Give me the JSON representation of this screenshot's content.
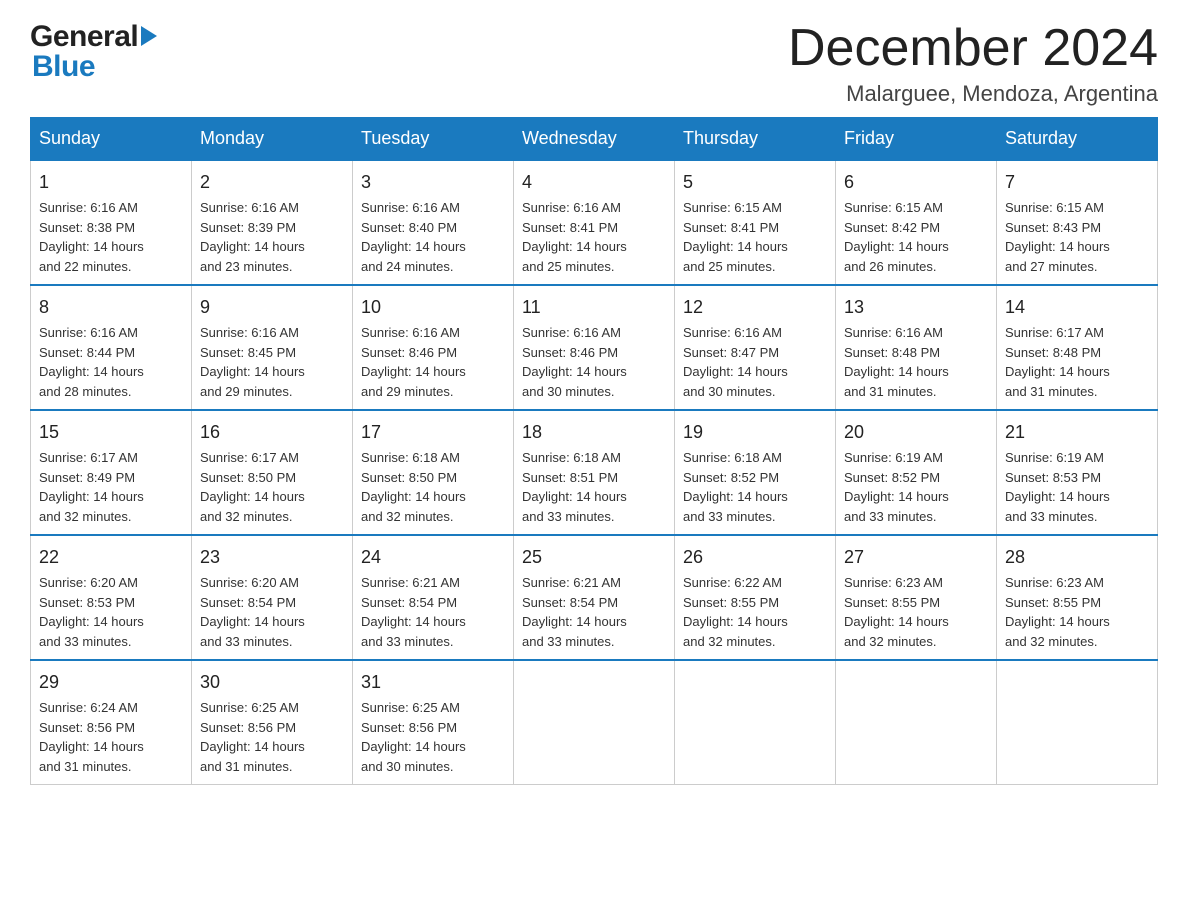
{
  "header": {
    "month_year": "December 2024",
    "location": "Malarguee, Mendoza, Argentina",
    "logo_general": "General",
    "logo_blue": "Blue"
  },
  "days_of_week": [
    "Sunday",
    "Monday",
    "Tuesday",
    "Wednesday",
    "Thursday",
    "Friday",
    "Saturday"
  ],
  "weeks": [
    [
      {
        "day": "1",
        "sunrise": "6:16 AM",
        "sunset": "8:38 PM",
        "daylight": "14 hours and 22 minutes."
      },
      {
        "day": "2",
        "sunrise": "6:16 AM",
        "sunset": "8:39 PM",
        "daylight": "14 hours and 23 minutes."
      },
      {
        "day": "3",
        "sunrise": "6:16 AM",
        "sunset": "8:40 PM",
        "daylight": "14 hours and 24 minutes."
      },
      {
        "day": "4",
        "sunrise": "6:16 AM",
        "sunset": "8:41 PM",
        "daylight": "14 hours and 25 minutes."
      },
      {
        "day": "5",
        "sunrise": "6:15 AM",
        "sunset": "8:41 PM",
        "daylight": "14 hours and 25 minutes."
      },
      {
        "day": "6",
        "sunrise": "6:15 AM",
        "sunset": "8:42 PM",
        "daylight": "14 hours and 26 minutes."
      },
      {
        "day": "7",
        "sunrise": "6:15 AM",
        "sunset": "8:43 PM",
        "daylight": "14 hours and 27 minutes."
      }
    ],
    [
      {
        "day": "8",
        "sunrise": "6:16 AM",
        "sunset": "8:44 PM",
        "daylight": "14 hours and 28 minutes."
      },
      {
        "day": "9",
        "sunrise": "6:16 AM",
        "sunset": "8:45 PM",
        "daylight": "14 hours and 29 minutes."
      },
      {
        "day": "10",
        "sunrise": "6:16 AM",
        "sunset": "8:46 PM",
        "daylight": "14 hours and 29 minutes."
      },
      {
        "day": "11",
        "sunrise": "6:16 AM",
        "sunset": "8:46 PM",
        "daylight": "14 hours and 30 minutes."
      },
      {
        "day": "12",
        "sunrise": "6:16 AM",
        "sunset": "8:47 PM",
        "daylight": "14 hours and 30 minutes."
      },
      {
        "day": "13",
        "sunrise": "6:16 AM",
        "sunset": "8:48 PM",
        "daylight": "14 hours and 31 minutes."
      },
      {
        "day": "14",
        "sunrise": "6:17 AM",
        "sunset": "8:48 PM",
        "daylight": "14 hours and 31 minutes."
      }
    ],
    [
      {
        "day": "15",
        "sunrise": "6:17 AM",
        "sunset": "8:49 PM",
        "daylight": "14 hours and 32 minutes."
      },
      {
        "day": "16",
        "sunrise": "6:17 AM",
        "sunset": "8:50 PM",
        "daylight": "14 hours and 32 minutes."
      },
      {
        "day": "17",
        "sunrise": "6:18 AM",
        "sunset": "8:50 PM",
        "daylight": "14 hours and 32 minutes."
      },
      {
        "day": "18",
        "sunrise": "6:18 AM",
        "sunset": "8:51 PM",
        "daylight": "14 hours and 33 minutes."
      },
      {
        "day": "19",
        "sunrise": "6:18 AM",
        "sunset": "8:52 PM",
        "daylight": "14 hours and 33 minutes."
      },
      {
        "day": "20",
        "sunrise": "6:19 AM",
        "sunset": "8:52 PM",
        "daylight": "14 hours and 33 minutes."
      },
      {
        "day": "21",
        "sunrise": "6:19 AM",
        "sunset": "8:53 PM",
        "daylight": "14 hours and 33 minutes."
      }
    ],
    [
      {
        "day": "22",
        "sunrise": "6:20 AM",
        "sunset": "8:53 PM",
        "daylight": "14 hours and 33 minutes."
      },
      {
        "day": "23",
        "sunrise": "6:20 AM",
        "sunset": "8:54 PM",
        "daylight": "14 hours and 33 minutes."
      },
      {
        "day": "24",
        "sunrise": "6:21 AM",
        "sunset": "8:54 PM",
        "daylight": "14 hours and 33 minutes."
      },
      {
        "day": "25",
        "sunrise": "6:21 AM",
        "sunset": "8:54 PM",
        "daylight": "14 hours and 33 minutes."
      },
      {
        "day": "26",
        "sunrise": "6:22 AM",
        "sunset": "8:55 PM",
        "daylight": "14 hours and 32 minutes."
      },
      {
        "day": "27",
        "sunrise": "6:23 AM",
        "sunset": "8:55 PM",
        "daylight": "14 hours and 32 minutes."
      },
      {
        "day": "28",
        "sunrise": "6:23 AM",
        "sunset": "8:55 PM",
        "daylight": "14 hours and 32 minutes."
      }
    ],
    [
      {
        "day": "29",
        "sunrise": "6:24 AM",
        "sunset": "8:56 PM",
        "daylight": "14 hours and 31 minutes."
      },
      {
        "day": "30",
        "sunrise": "6:25 AM",
        "sunset": "8:56 PM",
        "daylight": "14 hours and 31 minutes."
      },
      {
        "day": "31",
        "sunrise": "6:25 AM",
        "sunset": "8:56 PM",
        "daylight": "14 hours and 30 minutes."
      },
      null,
      null,
      null,
      null
    ]
  ],
  "labels": {
    "sunrise": "Sunrise:",
    "sunset": "Sunset:",
    "daylight": "Daylight:"
  }
}
